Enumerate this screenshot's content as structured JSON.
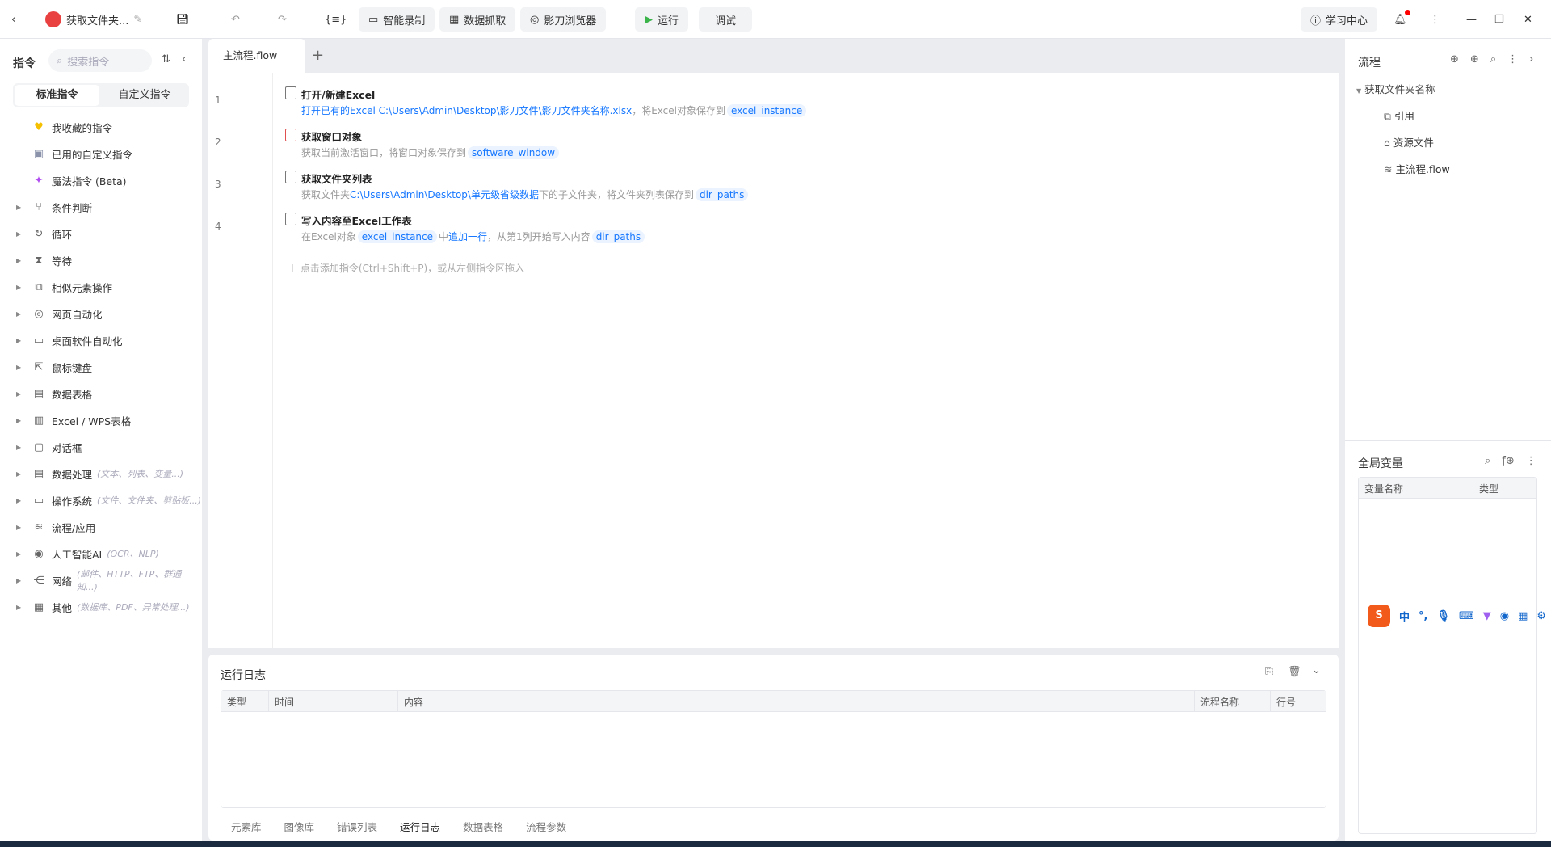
{
  "topbar": {
    "title": "获取文件夹...",
    "record": "智能录制",
    "scrape": "数据抓取",
    "browser": "影刀浏览器",
    "run": "运行",
    "debug": "调试",
    "learn": "学习中心"
  },
  "sidebar": {
    "title": "指令",
    "search_placeholder": "搜索指令",
    "tabs": [
      "标准指令",
      "自定义指令"
    ],
    "special": [
      "我收藏的指令",
      "已用的自定义指令",
      "魔法指令 (Beta)"
    ],
    "groups": [
      {
        "label": "条件判断",
        "hint": ""
      },
      {
        "label": "循环",
        "hint": ""
      },
      {
        "label": "等待",
        "hint": ""
      },
      {
        "label": "相似元素操作",
        "hint": ""
      },
      {
        "label": "网页自动化",
        "hint": ""
      },
      {
        "label": "桌面软件自动化",
        "hint": ""
      },
      {
        "label": "鼠标键盘",
        "hint": ""
      },
      {
        "label": "数据表格",
        "hint": ""
      },
      {
        "label": "Excel / WPS表格",
        "hint": ""
      },
      {
        "label": "对话框",
        "hint": ""
      },
      {
        "label": "数据处理",
        "hint": "(文本、列表、变量...)"
      },
      {
        "label": "操作系统",
        "hint": "(文件、文件夹、剪贴板...)"
      },
      {
        "label": "流程/应用",
        "hint": ""
      },
      {
        "label": "人工智能AI",
        "hint": "(OCR、NLP)"
      },
      {
        "label": "网络",
        "hint": "(邮件、HTTP、FTP、群通知...)"
      },
      {
        "label": "其他",
        "hint": "(数据库、PDF、异常处理...)"
      }
    ]
  },
  "editor": {
    "tab": "主流程.flow",
    "steps": [
      {
        "num": "1",
        "title": "打开/新建Excel",
        "d1": "打开已有的Excel C:\\Users\\Admin\\Desktop\\影刀文件\\影刀文件夹名称.xlsx",
        "d2": "，将Excel对象保存到",
        "v1": "excel_instance"
      },
      {
        "num": "2",
        "title": "获取窗口对象",
        "d1": "获取当前激活窗口，将窗口对象保存到",
        "v1": "software_window"
      },
      {
        "num": "3",
        "title": "获取文件夹列表",
        "d1": "获取文件夹",
        "p": "C:\\Users\\Admin\\Desktop\\单元级省级数据",
        "d2": "下的子文件夹，将文件夹列表保存到",
        "v1": "dir_paths"
      },
      {
        "num": "4",
        "title": "写入内容至Excel工作表",
        "d1": "在Excel对象",
        "v1": "excel_instance",
        "m": "中",
        "a": "追加一行",
        "d2": "，从第1列开始写入内容",
        "v2": "dir_paths"
      }
    ],
    "add_hint": "点击添加指令(Ctrl+Shift+P)，或从左侧指令区拖入"
  },
  "log": {
    "title": "运行日志",
    "columns": [
      "类型",
      "时间",
      "内容",
      "流程名称",
      "行号"
    ],
    "tabs": [
      "元素库",
      "图像库",
      "错误列表",
      "运行日志",
      "数据表格",
      "流程参数"
    ]
  },
  "right": {
    "title": "流程",
    "root": "获取文件夹名称",
    "items": [
      "引用",
      "资源文件",
      "主流程.flow"
    ],
    "vars_title": "全局变量",
    "var_cols": [
      "变量名称",
      "类型"
    ]
  },
  "ime": {
    "lang": "中"
  }
}
